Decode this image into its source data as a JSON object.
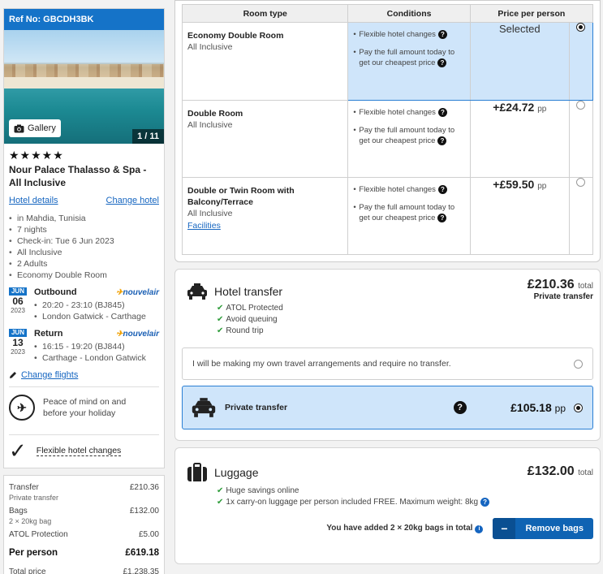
{
  "hotel": {
    "ref": "Ref No: GBCDH3BK",
    "gallery_label": "Gallery",
    "photo_counter": "1 / 11",
    "stars": "★★★★★",
    "name": "Nour Palace Thalasso & Spa - All Inclusive",
    "details_link": "Hotel details",
    "change_link": "Change hotel",
    "facts": [
      "in Mahdia, Tunisia",
      "7 nights",
      "Check-in: Tue 6 Jun 2023",
      "All Inclusive",
      "2 Adults",
      "Economy Double Room"
    ]
  },
  "flights": [
    {
      "mon": "JUN",
      "day": "06",
      "yr": "2023",
      "title": "Outbound",
      "airline": "nouvelair",
      "lines": [
        "20:20 - 23:10 (BJ845)",
        "London Gatwick - Carthage"
      ]
    },
    {
      "mon": "JUN",
      "day": "13",
      "yr": "2023",
      "title": "Return",
      "airline": "nouvelair",
      "lines": [
        "16:15 - 19:20 (BJ844)",
        "Carthage - London Gatwick"
      ]
    }
  ],
  "change_flights": "Change flights",
  "peace": {
    "line1": "Peace of mind on and",
    "line2": "before your holiday"
  },
  "flexible": "Flexible hotel changes",
  "price_summary": {
    "transfer": {
      "label": "Transfer",
      "sub": "Private transfer",
      "value": "£210.36"
    },
    "bags": {
      "label": "Bags",
      "sub": "2 × 20kg bag",
      "value": "£132.00"
    },
    "atol": {
      "label": "ATOL Protection",
      "value": "£5.00"
    },
    "per_person": {
      "label": "Per person",
      "value": "£619.18"
    },
    "total": {
      "label": "Total price",
      "value": "£1,238.35"
    }
  },
  "room_table": {
    "headers": [
      "Room type",
      "Conditions",
      "Price per person"
    ],
    "conditions": [
      "Flexible hotel changes",
      "Pay the full amount today to get our cheapest price"
    ],
    "rooms": [
      {
        "name": "Economy Double Room",
        "board": "All Inclusive",
        "extra": "",
        "price": "Selected",
        "unit": "",
        "selected": true
      },
      {
        "name": "Double Room",
        "board": "All Inclusive",
        "extra": "",
        "price": "+£24.72",
        "unit": "pp",
        "selected": false
      },
      {
        "name": "Double or Twin Room with Balcony/Terrace",
        "board": "All Inclusive",
        "extra": "Facilities",
        "price": "+£59.50",
        "unit": "pp",
        "selected": false
      }
    ]
  },
  "transfer": {
    "title": "Hotel transfer",
    "total": "£210.36",
    "total_unit": "total",
    "total_sub": "Private transfer",
    "ticks": [
      "ATOL Protected",
      "Avoid queuing",
      "Round trip"
    ],
    "own_option": "I will be making my own travel arrangements and require no transfer.",
    "private_label": "Private transfer",
    "private_price": "£105.18",
    "private_unit": "pp"
  },
  "luggage": {
    "title": "Luggage",
    "total": "£132.00",
    "total_unit": "total",
    "ticks": [
      "Huge savings online",
      "1x carry-on luggage per person included FREE. Maximum weight: 8kg"
    ],
    "note": "You have added 2 × 20kg bags in total",
    "remove": "Remove bags"
  }
}
